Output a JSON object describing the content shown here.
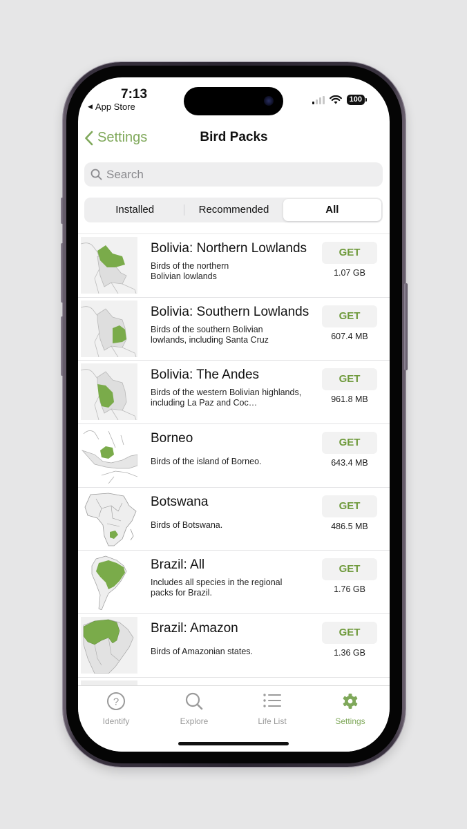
{
  "status_bar": {
    "time": "7:13",
    "back_app": "App Store",
    "battery": "100"
  },
  "nav": {
    "back_label": "Settings",
    "title": "Bird Packs"
  },
  "search": {
    "placeholder": "Search",
    "value": ""
  },
  "segments": [
    {
      "label": "Installed",
      "active": false
    },
    {
      "label": "Recommended",
      "active": false
    },
    {
      "label": "All",
      "active": true
    }
  ],
  "packs": [
    {
      "title": "Bolivia: Northern Lowlands",
      "description": "Birds of the northern Bolivian lowlands",
      "action": "GET",
      "size": "1.07 GB",
      "map": "bolivia-north"
    },
    {
      "title": "Bolivia: Southern Lowlands",
      "description": "Birds of the southern Bolivian lowlands, including Santa Cruz",
      "action": "GET",
      "size": "607.4 MB",
      "map": "bolivia-south"
    },
    {
      "title": "Bolivia: The Andes",
      "description": "Birds of the western Bolivian highlands, including La Paz and Coc…",
      "action": "GET",
      "size": "961.8 MB",
      "map": "bolivia-andes"
    },
    {
      "title": "Borneo",
      "description": "Birds of the island of Borneo.",
      "action": "GET",
      "size": "643.4 MB",
      "map": "borneo"
    },
    {
      "title": "Botswana",
      "description": "Birds of Botswana.",
      "action": "GET",
      "size": "486.5 MB",
      "map": "botswana"
    },
    {
      "title": "Brazil: All",
      "description": "Includes all species in the regional packs for Brazil.",
      "action": "GET",
      "size": "1.76 GB",
      "map": "brazil-all"
    },
    {
      "title": "Brazil: Amazon",
      "description": "Birds of Amazonian states.",
      "action": "GET",
      "size": "1.36 GB",
      "map": "brazil-amazon"
    }
  ],
  "tabbar": [
    {
      "label": "Identify",
      "icon": "question-circle-icon",
      "active": false
    },
    {
      "label": "Explore",
      "icon": "search-icon",
      "active": false
    },
    {
      "label": "Life List",
      "icon": "list-icon",
      "active": false
    },
    {
      "label": "Settings",
      "icon": "gear-icon",
      "active": true
    }
  ],
  "colors": {
    "accent": "#7fa85a",
    "get_text": "#6f9a3c",
    "map_highlight": "#7aab4a"
  }
}
